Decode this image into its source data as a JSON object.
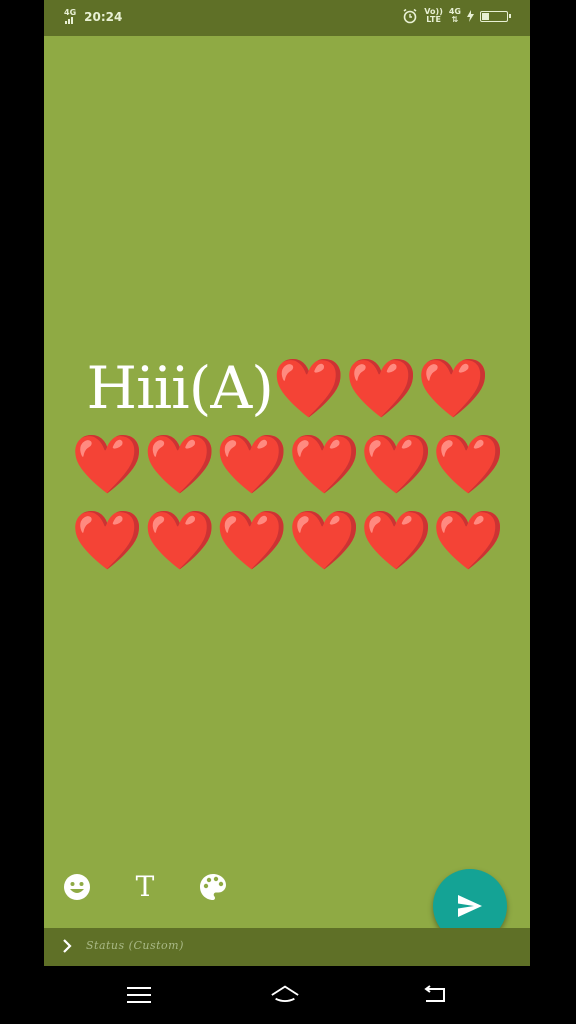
{
  "statusbar": {
    "network_left": "4G",
    "time": "20:24",
    "volte_top": "Vo))",
    "volte_bottom": "LTE",
    "network_right": "4G",
    "battery_level": "27"
  },
  "status_editor": {
    "text_prefix": "Hiii(A)",
    "hearts": "❤️❤️❤️❤️❤️❤️❤️❤️❤️❤️❤️❤️❤️❤️❤️",
    "background_color": "#8faa44",
    "text_color": "#ffffff"
  },
  "tools": {
    "emoji_icon": "smiley-icon",
    "text_label": "T",
    "palette_icon": "palette-icon"
  },
  "send": {
    "icon": "send-icon",
    "color": "#14a395"
  },
  "caption": {
    "placeholder": "Status (Custom)"
  },
  "navbar": {
    "menu_icon": "menu-icon",
    "home_icon": "home-icon",
    "back_icon": "back-icon"
  }
}
